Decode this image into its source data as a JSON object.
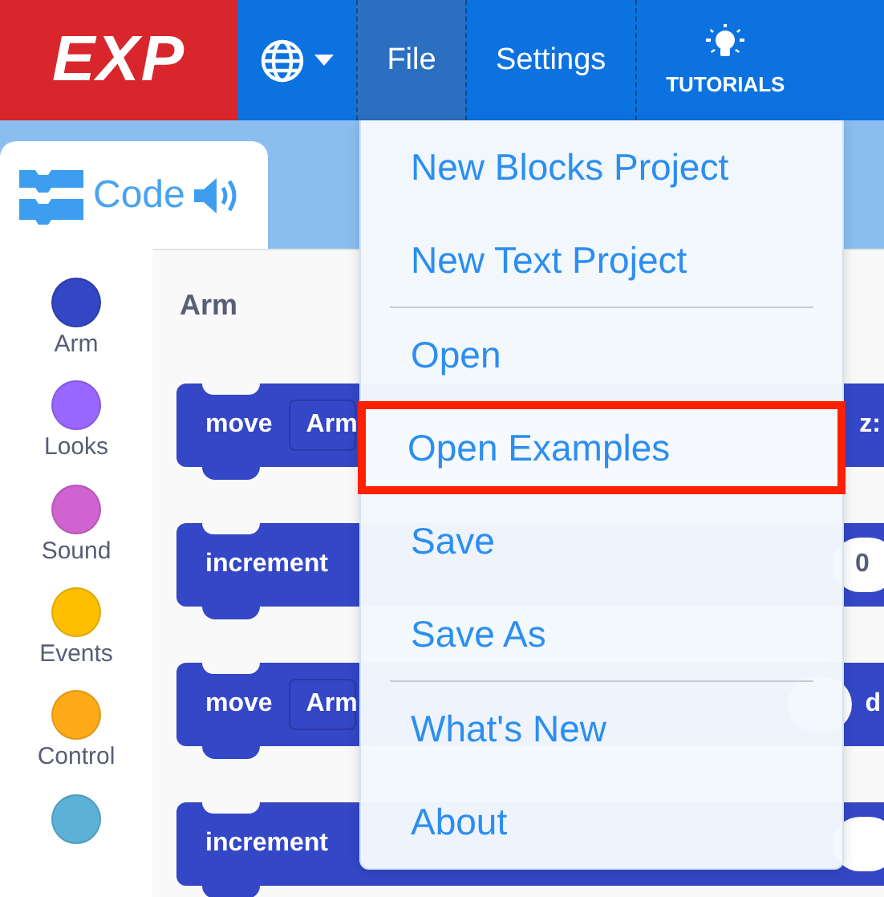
{
  "header": {
    "logo": "EXP",
    "menus": [
      {
        "label": "File",
        "selected": true
      },
      {
        "label": "Settings",
        "selected": false
      }
    ],
    "tutorials": "TUTORIALS"
  },
  "code_tab": {
    "label": "Code"
  },
  "categories": [
    {
      "label": "Arm",
      "color": "#3346c4"
    },
    {
      "label": "Looks",
      "color": "#9966ff"
    },
    {
      "label": "Sound",
      "color": "#cf63cf"
    },
    {
      "label": "Events",
      "color": "#ffbf00"
    },
    {
      "label": "Control",
      "color": "#ffab19"
    },
    {
      "color": "#5cb1d6"
    }
  ],
  "flyout": {
    "heading": "Arm",
    "blocks": [
      {
        "label": "move",
        "field": "Arm",
        "tail": [
          {
            "kind": "text",
            "text": "z:"
          }
        ]
      },
      {
        "label": "increment",
        "tail": [
          {
            "kind": "pill",
            "text": "0"
          }
        ]
      },
      {
        "label": "move",
        "field": "Arm",
        "tail": [
          {
            "kind": "pill"
          },
          {
            "kind": "text",
            "text": "d"
          }
        ]
      },
      {
        "label": "increment",
        "tail": [
          {
            "kind": "pill"
          }
        ]
      }
    ]
  },
  "file_menu": {
    "groups": [
      [
        {
          "label": "New Blocks Project",
          "highlighted": false
        },
        {
          "label": "New Text Project",
          "highlighted": false
        }
      ],
      [
        {
          "label": "Open",
          "highlighted": false
        },
        {
          "label": "Open Examples",
          "highlighted": true
        },
        {
          "label": "Save",
          "highlighted": false
        },
        {
          "label": "Save As",
          "highlighted": false
        }
      ],
      [
        {
          "label": "What's New",
          "highlighted": false
        },
        {
          "label": "About",
          "highlighted": false
        }
      ]
    ]
  }
}
